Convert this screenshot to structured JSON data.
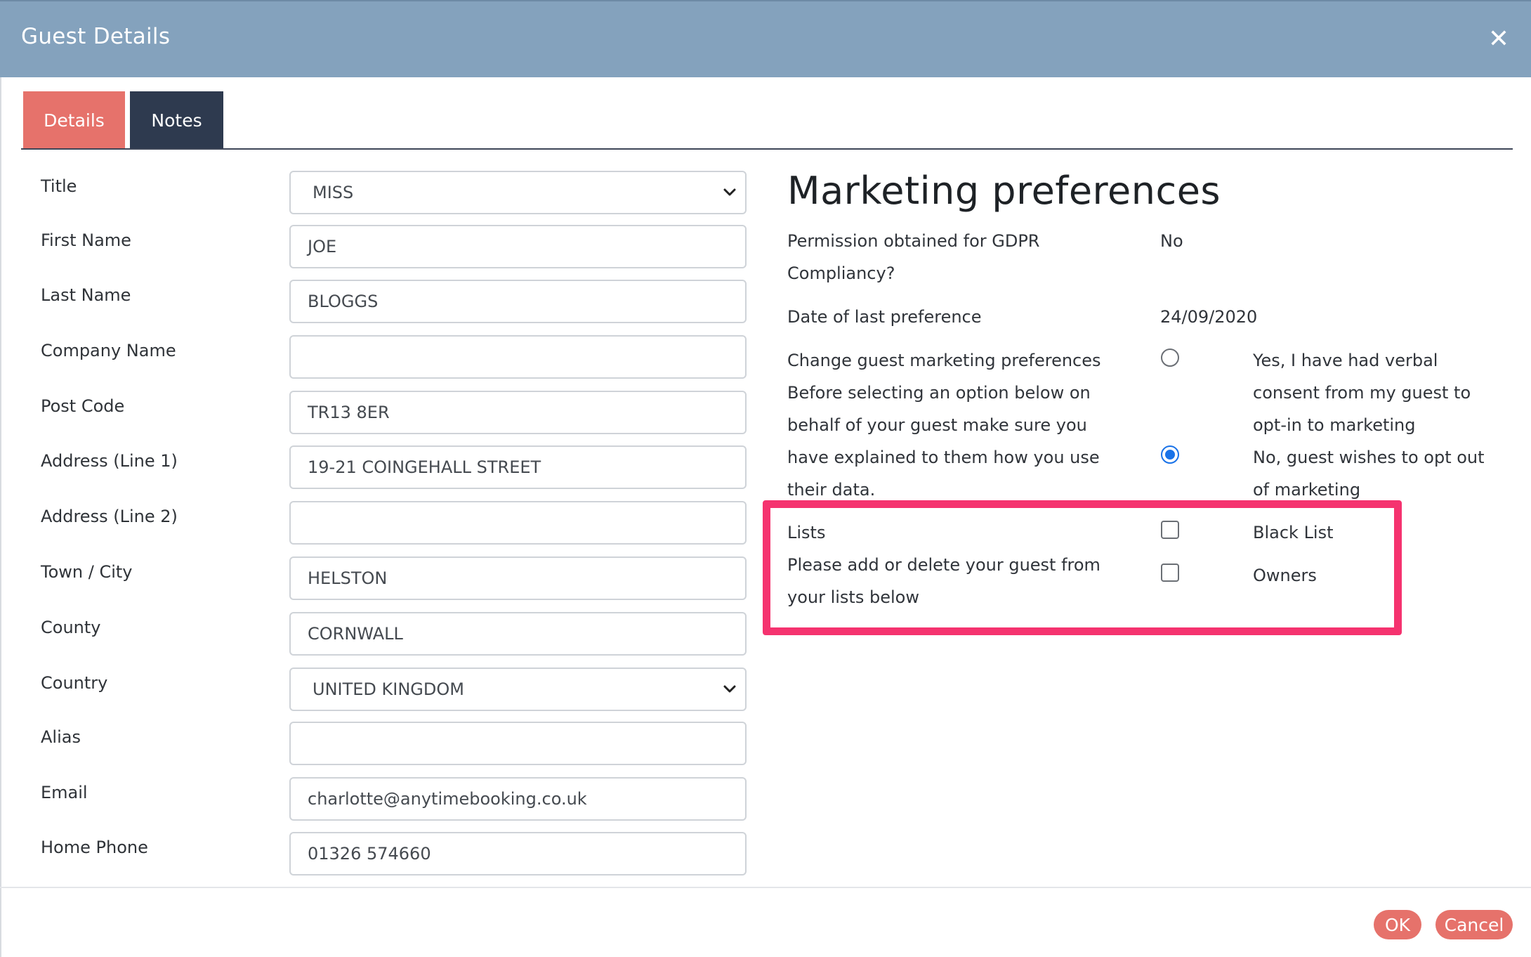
{
  "window": {
    "title": "Guest Details"
  },
  "tabs": [
    {
      "label": "Details",
      "active": true
    },
    {
      "label": "Notes",
      "active": false
    }
  ],
  "form": {
    "fields": [
      {
        "label": "Title",
        "value": "MISS",
        "type": "select"
      },
      {
        "label": "First Name",
        "value": "JOE",
        "type": "text"
      },
      {
        "label": "Last Name",
        "value": "BLOGGS",
        "type": "text"
      },
      {
        "label": "Company Name",
        "value": "",
        "type": "text"
      },
      {
        "label": "Post Code",
        "value": "TR13 8ER",
        "type": "text"
      },
      {
        "label": "Address (Line 1)",
        "value": "19-21 COINGEHALL STREET",
        "type": "text"
      },
      {
        "label": "Address (Line 2)",
        "value": "",
        "type": "text"
      },
      {
        "label": "Town / City",
        "value": "HELSTON",
        "type": "text"
      },
      {
        "label": "County",
        "value": "CORNWALL",
        "type": "text"
      },
      {
        "label": "Country",
        "value": "UNITED KINGDOM",
        "type": "select"
      },
      {
        "label": "Alias",
        "value": "",
        "type": "text"
      },
      {
        "label": "Email",
        "value": "charlotte@anytimebooking.co.uk",
        "type": "text"
      },
      {
        "label": "Home Phone",
        "value": "01326 574660",
        "type": "text"
      }
    ]
  },
  "marketing": {
    "title": "Marketing preferences",
    "gdpr_label": "Permission obtained for GDPR Compliancy?",
    "gdpr_value": "No",
    "last_pref_label": "Date of last preference",
    "last_pref_value": "24/09/2020",
    "change_label": "Change guest marketing preferences",
    "change_help": "Before selecting an option below on behalf of your guest make sure you have explained to them how you use their data.",
    "options": [
      {
        "label": "Yes, I have had verbal consent from my guest to opt-in to marketing",
        "selected": false
      },
      {
        "label": "No, guest wishes to opt out of marketing",
        "selected": true
      }
    ],
    "lists_label": "Lists",
    "lists_help": "Please add or delete your guest from your lists below",
    "lists": [
      {
        "label": "Black List",
        "checked": false
      },
      {
        "label": "Owners",
        "checked": false
      }
    ]
  },
  "footer": {
    "ok_label": "OK",
    "cancel_label": "Cancel"
  },
  "colors": {
    "header": "#84a2bd",
    "accent": "#e6726b",
    "tab_dark": "#2e3a4f",
    "highlight": "#f5336f",
    "radio": "#1a73e8"
  },
  "icons": {
    "close": "close-icon",
    "dropdown": "chevron-down-icon"
  }
}
